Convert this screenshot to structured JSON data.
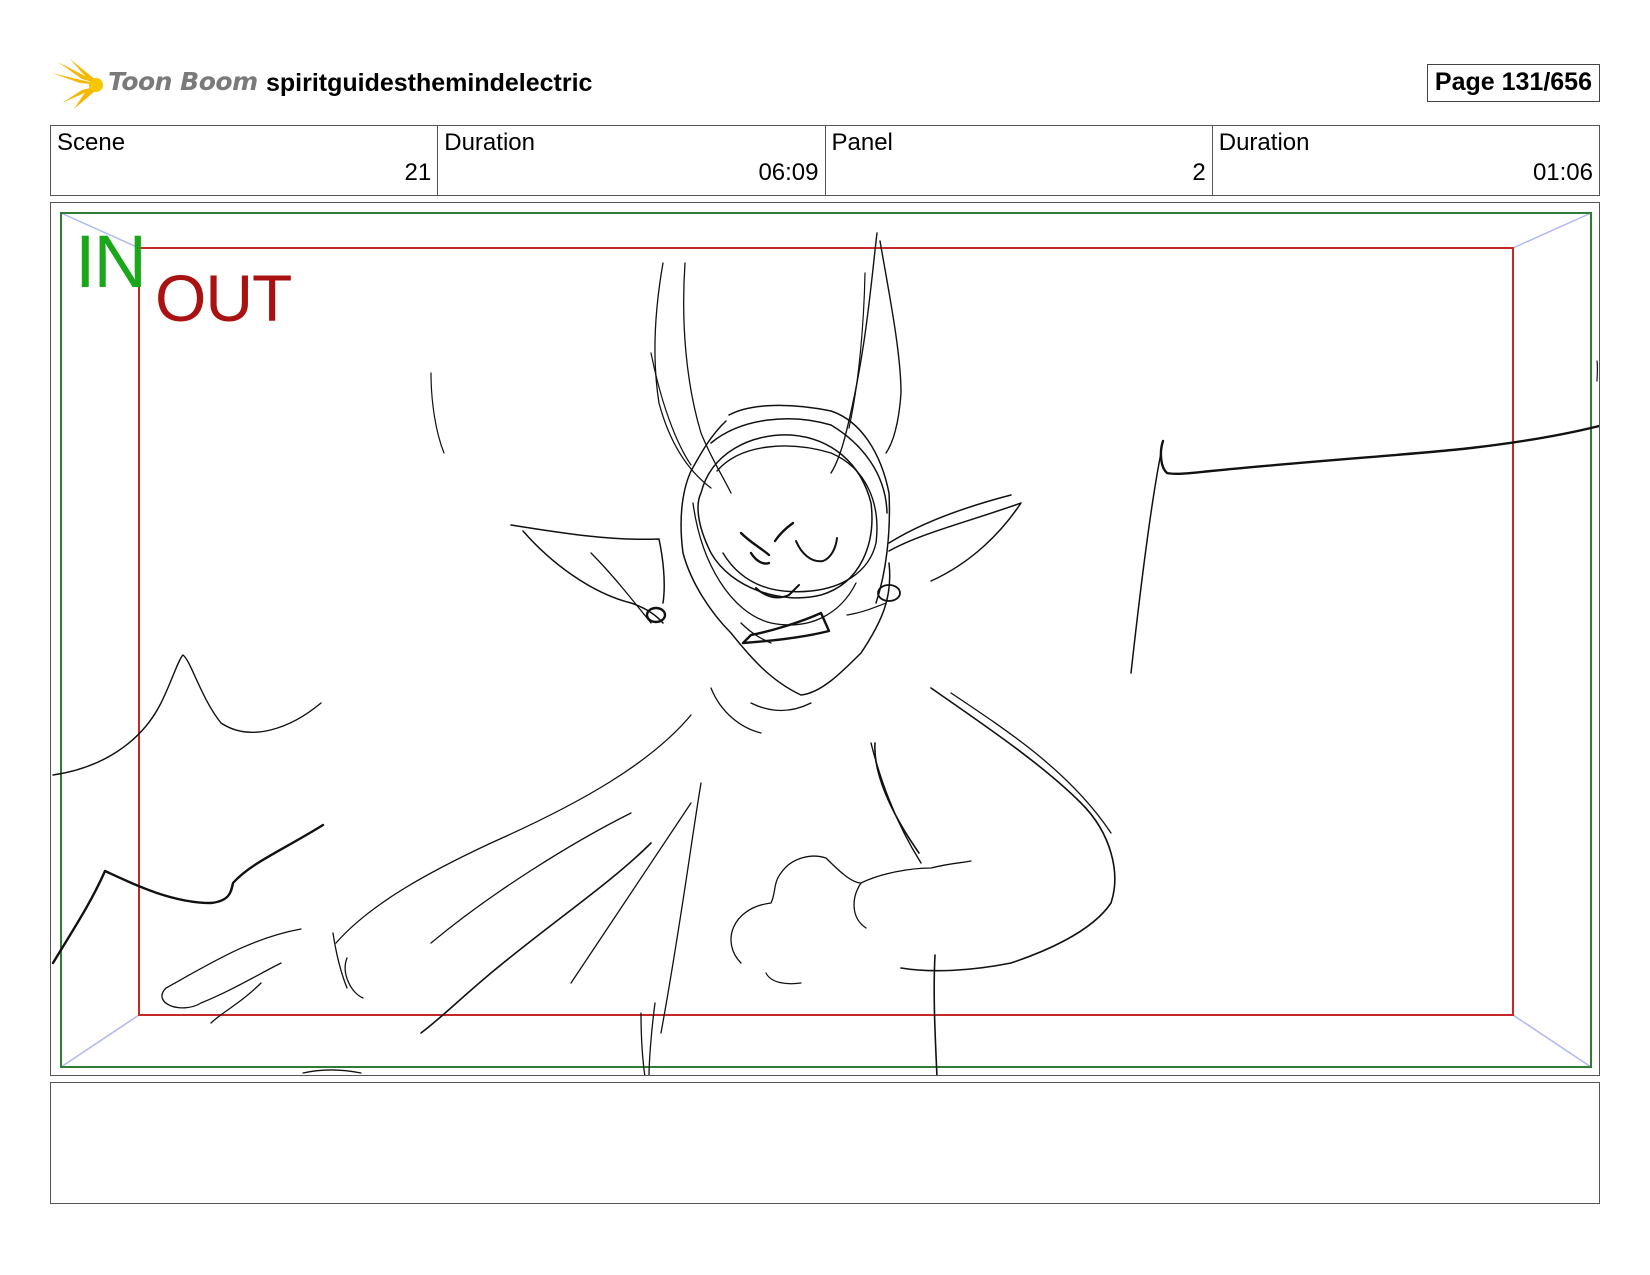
{
  "header": {
    "logo_text": "Toon Boom",
    "project_title": "spiritguidesthemindelectric",
    "page_label": "Page 131/656"
  },
  "info": {
    "scene_label": "Scene",
    "scene_value": "21",
    "scene_duration_label": "Duration",
    "scene_duration_value": "06:09",
    "panel_label": "Panel",
    "panel_value": "2",
    "panel_duration_label": "Duration",
    "panel_duration_value": "01:06"
  },
  "panel": {
    "in_label": "IN",
    "out_label": "OUT",
    "frame_colors": {
      "in_frame": "#2e7d32",
      "out_frame": "#c62828",
      "corner_guides": "#b0b8f0"
    }
  },
  "notes": {
    "text": ""
  }
}
